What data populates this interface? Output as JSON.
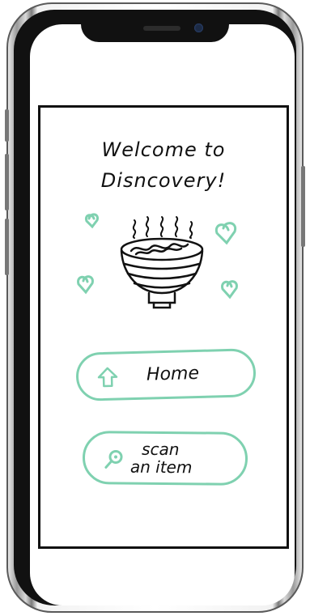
{
  "welcome": {
    "line1": "Welcome to",
    "line2": "Disncovery!"
  },
  "buttons": {
    "home_label": "Home",
    "scan_line1": "scan",
    "scan_line2": "an item"
  },
  "colors": {
    "accent": "#7fd1b0",
    "ink": "#111111"
  },
  "icons": [
    "heart-icon",
    "ramen-bowl-icon",
    "home-arrow-icon",
    "magnifier-icon"
  ]
}
